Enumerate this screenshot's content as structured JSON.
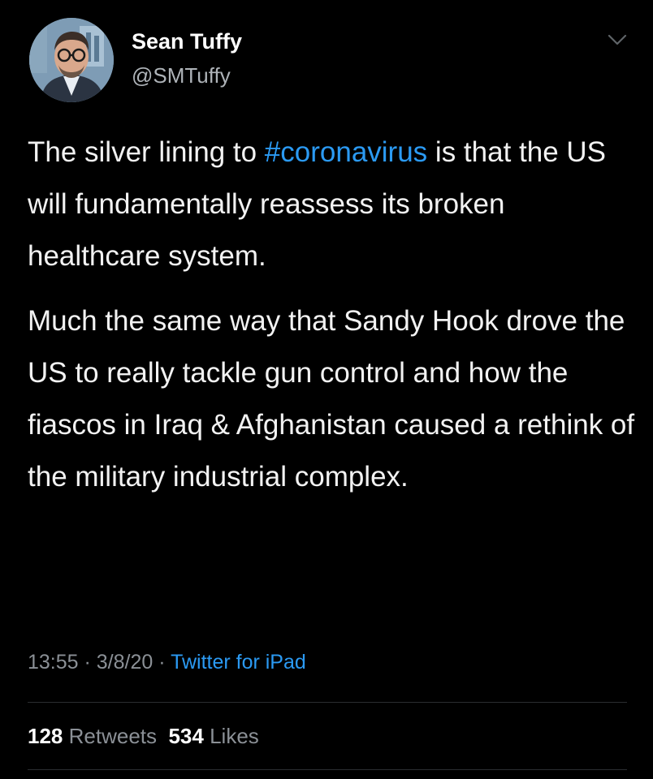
{
  "author": {
    "display_name": "Sean Tuffy",
    "handle": "@SMTuffy",
    "avatar_icon": "profile-photo"
  },
  "menu_icon": "chevron-down-icon",
  "tweet": {
    "paragraph1": {
      "before": "The silver lining to ",
      "hashtag": "#coronavirus",
      "after": " is that the US will fundamentally reassess its broken healthcare system."
    },
    "paragraph2": "Much the same way that Sandy Hook drove the US to really tackle gun control and how the fiascos in Iraq & Afghanistan caused a rethink of the military industrial complex."
  },
  "meta": {
    "time": "13:55",
    "separator": " · ",
    "date": "3/8/20",
    "source": "Twitter for iPad"
  },
  "stats": {
    "retweets_count": "128",
    "retweets_label": "Retweets",
    "likes_count": "534",
    "likes_label": "Likes"
  },
  "colors": {
    "background": "#000000",
    "link": "#2b9af3",
    "secondary_text": "#8b9096"
  }
}
